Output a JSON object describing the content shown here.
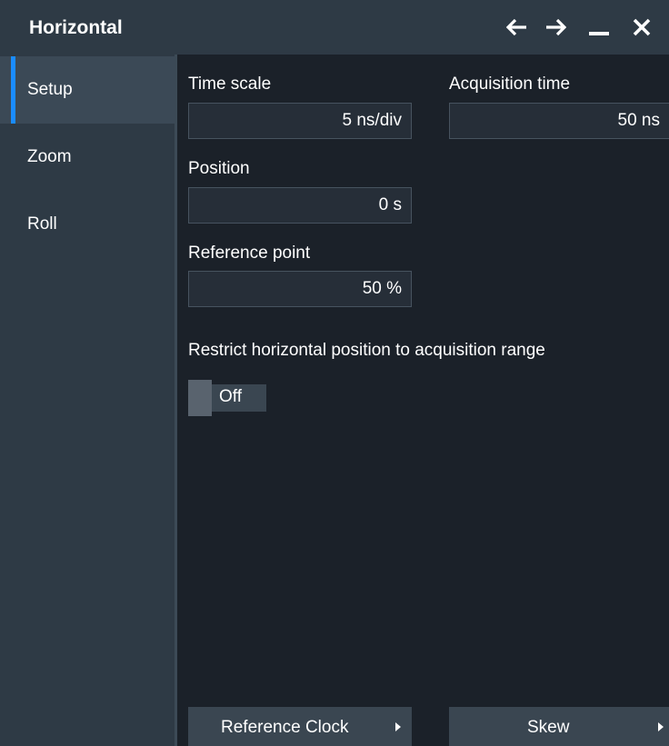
{
  "window": {
    "title": "Horizontal"
  },
  "titlebar_icons": [
    "arrow-left-icon",
    "arrow-right-icon",
    "minimize-icon",
    "close-icon"
  ],
  "sidebar": {
    "items": [
      {
        "label": "Setup",
        "active": true
      },
      {
        "label": "Zoom",
        "active": false
      },
      {
        "label": "Roll",
        "active": false
      }
    ]
  },
  "setup": {
    "time_scale": {
      "label": "Time scale",
      "value": "5 ns/div"
    },
    "acquisition_time": {
      "label": "Acquisition time",
      "value": "50 ns"
    },
    "position": {
      "label": "Position",
      "value": "0 s"
    },
    "reference_point": {
      "label": "Reference point",
      "value": "50 %"
    },
    "restrict": {
      "label": "Restrict horizontal position to acquisition range",
      "state": "Off"
    }
  },
  "footer": {
    "reference_clock_label": "Reference Clock",
    "skew_label": "Skew"
  },
  "colors": {
    "background": "#1b2129",
    "panel": "#2e3a45",
    "accent": "#1a8cff",
    "field": "#262e38"
  }
}
